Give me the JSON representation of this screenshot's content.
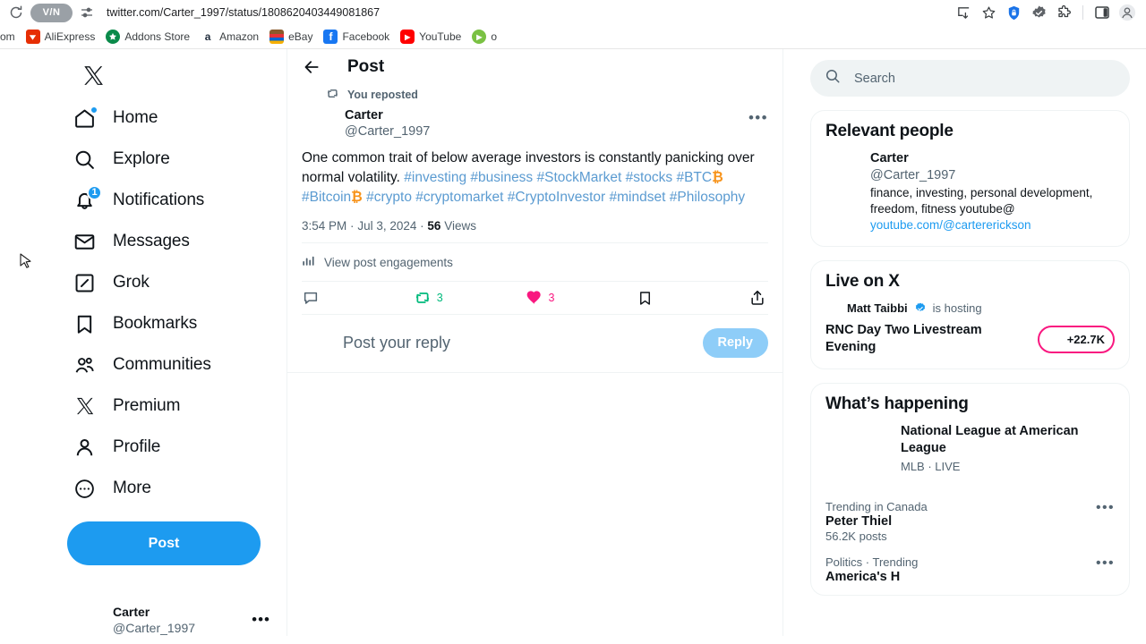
{
  "browser": {
    "reload_icon": "reload-icon",
    "vpn_badge": "V/N",
    "site_settings_icon": "site-settings-icon",
    "url": "twitter.com/Carter_1997/status/1808620403449081867",
    "right_icons": [
      {
        "name": "install-app-icon"
      },
      {
        "name": "bookmark-star-icon"
      },
      {
        "name": "shield-lock-icon"
      },
      {
        "name": "badge-check-extension-icon"
      },
      {
        "name": "extensions-puzzle-icon"
      },
      {
        "name": "side-panel-icon"
      },
      {
        "name": "profile-avatar-icon"
      }
    ],
    "bookmarks": [
      {
        "label": "om",
        "icon": ""
      },
      {
        "label": "AliExpress",
        "icon": "A"
      },
      {
        "label": "Addons Store",
        "icon": "✷"
      },
      {
        "label": "Amazon",
        "icon": "a"
      },
      {
        "label": "eBay",
        "icon": "e"
      },
      {
        "label": "Facebook",
        "icon": "f"
      },
      {
        "label": "YouTube",
        "icon": "▶"
      },
      {
        "label": "o",
        "icon": "▶"
      }
    ]
  },
  "sidebar": {
    "logo": "x-logo",
    "items": [
      {
        "label": "Home",
        "icon": "home-icon",
        "badge_dot": true
      },
      {
        "label": "Explore",
        "icon": "search-icon"
      },
      {
        "label": "Notifications",
        "icon": "bell-icon",
        "badge": "1"
      },
      {
        "label": "Messages",
        "icon": "envelope-icon"
      },
      {
        "label": "Grok",
        "icon": "grok-icon"
      },
      {
        "label": "Bookmarks",
        "icon": "bookmark-icon"
      },
      {
        "label": "Communities",
        "icon": "communities-icon"
      },
      {
        "label": "Premium",
        "icon": "x-premium-icon"
      },
      {
        "label": "Profile",
        "icon": "person-icon"
      },
      {
        "label": "More",
        "icon": "more-circle-icon"
      }
    ],
    "post_button": "Post",
    "account": {
      "name": "Carter",
      "handle": "@Carter_1997",
      "more": "•••"
    }
  },
  "post": {
    "header_title": "Post",
    "back_icon": "back-arrow-icon",
    "reposted_label": "You reposted",
    "author": {
      "name": "Carter",
      "handle": "@Carter_1997"
    },
    "more_menu": "•••",
    "body_plain": "One common trait of below average investors is constantly panicking over normal volatility. ",
    "hashtags": [
      "#investing",
      "#business",
      "#StockMarket",
      "#stocks",
      "#BTC",
      "#Bitcoin",
      "#crypto",
      "#cryptomarket",
      "#CryptoInvestor",
      "#mindset",
      "#Philosophy"
    ],
    "bitcoin_glyph": "₿",
    "timestamp_time": "3:54 PM",
    "timestamp_date": "Jul 3, 2024",
    "views_count": "56",
    "views_label": "Views",
    "dot": "·",
    "engagements_label": "View post engagements",
    "actions": {
      "reply": {
        "icon": "reply-bubble-icon",
        "count": ""
      },
      "repost": {
        "icon": "repost-icon",
        "count": "3",
        "color": "#00ba7c"
      },
      "like": {
        "icon": "heart-filled-icon",
        "count": "3",
        "color": "#f91880"
      },
      "bookmark": {
        "icon": "bookmark-icon",
        "count": ""
      },
      "share": {
        "icon": "share-icon",
        "count": ""
      }
    },
    "reply_box": {
      "placeholder": "Post your reply",
      "button_label": "Reply"
    }
  },
  "right": {
    "search": {
      "placeholder": "Search",
      "icon": "search-icon"
    },
    "relevant_people": {
      "title": "Relevant people",
      "person": {
        "name": "Carter",
        "handle": "@Carter_1997",
        "bio": "finance, investing, personal development, freedom, fitness youtube@",
        "link": "youtube.com/@cartererickson"
      }
    },
    "live_on_x": {
      "title": "Live on X",
      "host_name": "Matt Taibbi",
      "host_suffix": "is hosting",
      "verified_icon": "verified-badge-icon",
      "stream_title": "RNC Day Two Livestream Evening",
      "listeners": "+22.7K"
    },
    "whats_happening": {
      "title": "What’s happening",
      "news": {
        "title": "National League at American League",
        "subtitle": "MLB · LIVE",
        "thumb": "mlb-teams-photo"
      },
      "trends": [
        {
          "category": "Trending in Canada",
          "name": "Peter Thiel",
          "count": "56.2K posts",
          "more": "•••"
        },
        {
          "category": "Politics · Trending",
          "name": "America's H",
          "count": "",
          "more": "•••"
        }
      ]
    }
  },
  "colors": {
    "accent": "#1d9bf0",
    "like": "#f91880",
    "repost": "#00ba7c",
    "link": "#5b9bd1",
    "muted": "#536471"
  }
}
